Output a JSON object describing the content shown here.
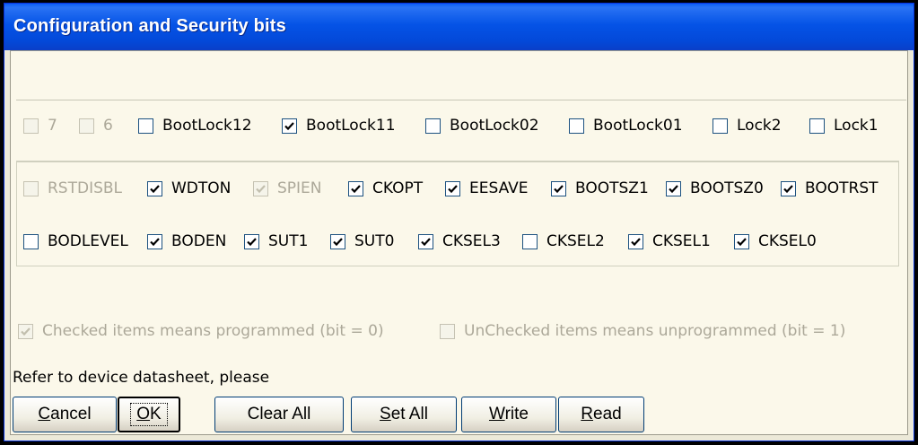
{
  "window": {
    "title": "Configuration and Security bits"
  },
  "lock_bits": [
    {
      "label": "7",
      "checked": false,
      "enabled": false
    },
    {
      "label": "6",
      "checked": false,
      "enabled": false
    },
    {
      "label": "BootLock12",
      "checked": false,
      "enabled": true
    },
    {
      "label": "BootLock11",
      "checked": true,
      "enabled": true
    },
    {
      "label": "BootLock02",
      "checked": false,
      "enabled": true
    },
    {
      "label": "BootLock01",
      "checked": false,
      "enabled": true
    },
    {
      "label": "Lock2",
      "checked": false,
      "enabled": true
    },
    {
      "label": "Lock1",
      "checked": false,
      "enabled": true
    }
  ],
  "fuse_high": [
    {
      "label": "RSTDISBL",
      "checked": false,
      "enabled": false
    },
    {
      "label": "WDTON",
      "checked": true,
      "enabled": true
    },
    {
      "label": "SPIEN",
      "checked": true,
      "enabled": false
    },
    {
      "label": "CKOPT",
      "checked": true,
      "enabled": true
    },
    {
      "label": "EESAVE",
      "checked": true,
      "enabled": true
    },
    {
      "label": "BOOTSZ1",
      "checked": true,
      "enabled": true
    },
    {
      "label": "BOOTSZ0",
      "checked": true,
      "enabled": true
    },
    {
      "label": "BOOTRST",
      "checked": true,
      "enabled": true
    }
  ],
  "fuse_low": [
    {
      "label": "BODLEVEL",
      "checked": false,
      "enabled": true
    },
    {
      "label": "BODEN",
      "checked": true,
      "enabled": true
    },
    {
      "label": "SUT1",
      "checked": true,
      "enabled": true
    },
    {
      "label": "SUT0",
      "checked": true,
      "enabled": true
    },
    {
      "label": "CKSEL3",
      "checked": true,
      "enabled": true
    },
    {
      "label": "CKSEL2",
      "checked": false,
      "enabled": true
    },
    {
      "label": "CKSEL1",
      "checked": true,
      "enabled": true
    },
    {
      "label": "CKSEL0",
      "checked": true,
      "enabled": true
    }
  ],
  "legend": {
    "checked": {
      "label": "Checked items means programmed (bit = 0)",
      "checked": true,
      "enabled": false
    },
    "unchecked": {
      "label": "UnChecked items means unprogrammed (bit = 1)",
      "checked": false,
      "enabled": false
    }
  },
  "notice": "Refer to device datasheet, please",
  "buttons": {
    "cancel": {
      "label": "Cancel",
      "mnemonic": "C"
    },
    "ok": {
      "label": "OK",
      "mnemonic": "O"
    },
    "clear_all": {
      "label": "Clear All",
      "mnemonic": ""
    },
    "set_all": {
      "label": "Set All",
      "mnemonic": "S"
    },
    "write": {
      "label": "Write",
      "mnemonic": "W"
    },
    "read": {
      "label": "Read",
      "mnemonic": "R"
    }
  }
}
